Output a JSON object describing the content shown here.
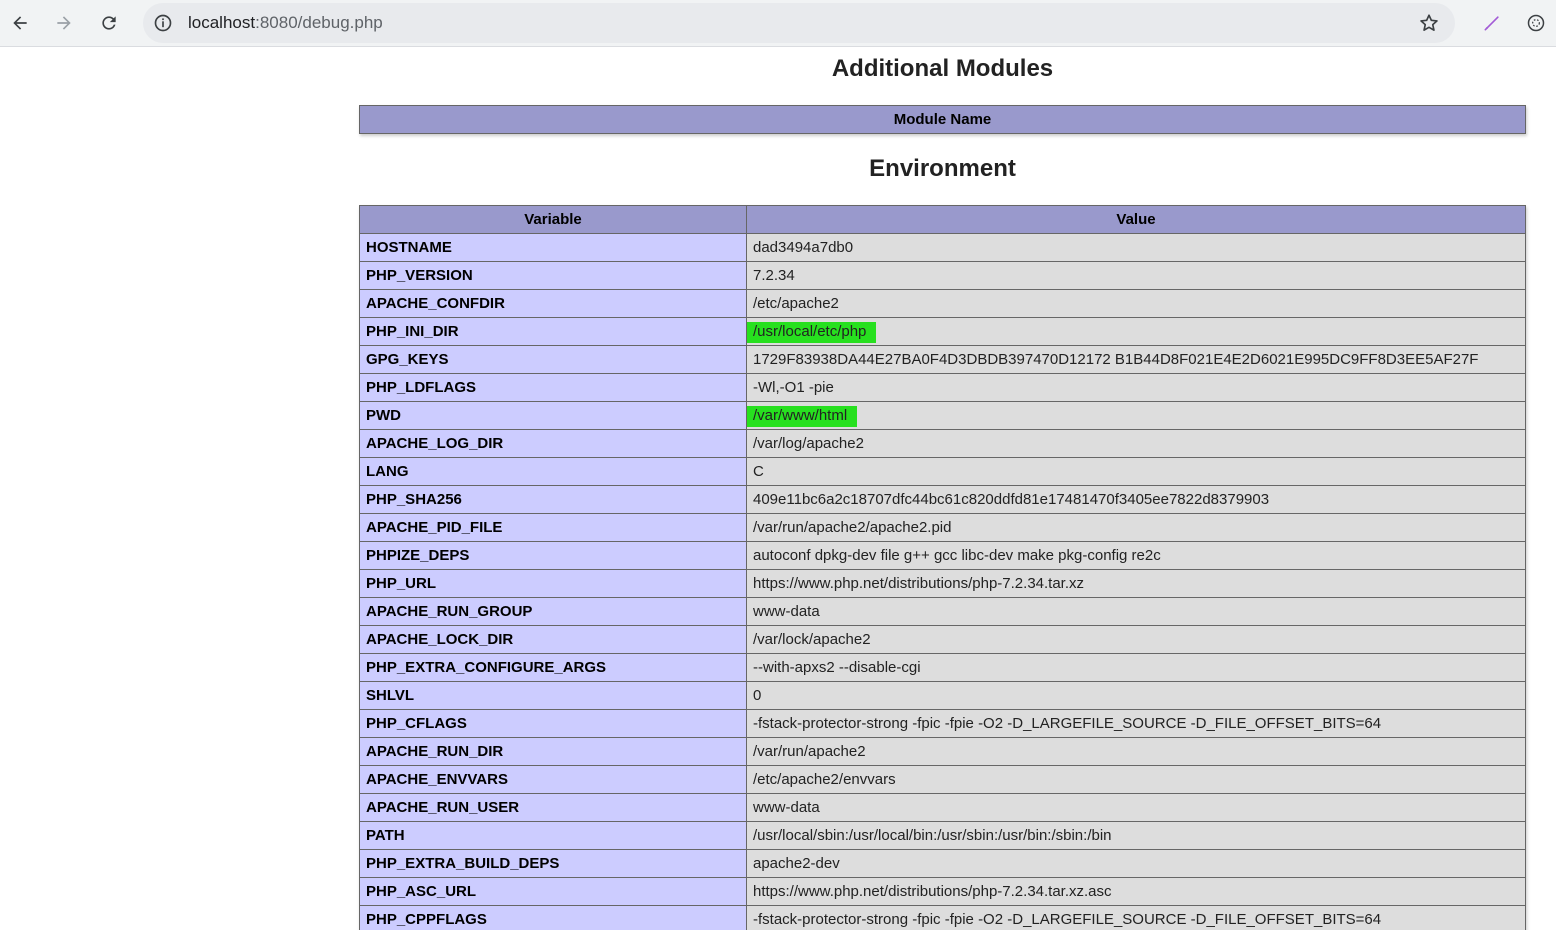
{
  "browser": {
    "url_host": "localhost",
    "url_path": ":8080/debug.php"
  },
  "modules_section": {
    "title": "Additional Modules",
    "header": "Module Name"
  },
  "environment_section": {
    "title": "Environment",
    "headers": [
      "Variable",
      "Value"
    ],
    "rows": [
      {
        "name": "HOSTNAME",
        "value": "dad3494a7db0"
      },
      {
        "name": "PHP_VERSION",
        "value": "7.2.34"
      },
      {
        "name": "APACHE_CONFDIR",
        "value": "/etc/apache2"
      },
      {
        "name": "PHP_INI_DIR",
        "value": "/usr/local/etc/php",
        "highlight": true
      },
      {
        "name": "GPG_KEYS",
        "value": "1729F83938DA44E27BA0F4D3DBDB397470D12172 B1B44D8F021E4E2D6021E995DC9FF8D3EE5AF27F"
      },
      {
        "name": "PHP_LDFLAGS",
        "value": "-Wl,-O1 -pie"
      },
      {
        "name": "PWD",
        "value": "/var/www/html",
        "highlight": true
      },
      {
        "name": "APACHE_LOG_DIR",
        "value": "/var/log/apache2"
      },
      {
        "name": "LANG",
        "value": "C"
      },
      {
        "name": "PHP_SHA256",
        "value": "409e11bc6a2c18707dfc44bc61c820ddfd81e17481470f3405ee7822d8379903"
      },
      {
        "name": "APACHE_PID_FILE",
        "value": "/var/run/apache2/apache2.pid"
      },
      {
        "name": "PHPIZE_DEPS",
        "value": "autoconf dpkg-dev file g++ gcc libc-dev make pkg-config re2c"
      },
      {
        "name": "PHP_URL",
        "value": "https://www.php.net/distributions/php-7.2.34.tar.xz"
      },
      {
        "name": "APACHE_RUN_GROUP",
        "value": "www-data"
      },
      {
        "name": "APACHE_LOCK_DIR",
        "value": "/var/lock/apache2"
      },
      {
        "name": "PHP_EXTRA_CONFIGURE_ARGS",
        "value": "--with-apxs2 --disable-cgi"
      },
      {
        "name": "SHLVL",
        "value": "0"
      },
      {
        "name": "PHP_CFLAGS",
        "value": "-fstack-protector-strong -fpic -fpie -O2 -D_LARGEFILE_SOURCE -D_FILE_OFFSET_BITS=64"
      },
      {
        "name": "APACHE_RUN_DIR",
        "value": "/var/run/apache2"
      },
      {
        "name": "APACHE_ENVVARS",
        "value": "/etc/apache2/envvars"
      },
      {
        "name": "APACHE_RUN_USER",
        "value": "www-data"
      },
      {
        "name": "PATH",
        "value": "/usr/local/sbin:/usr/local/bin:/usr/sbin:/usr/bin:/sbin:/bin"
      },
      {
        "name": "PHP_EXTRA_BUILD_DEPS",
        "value": "apache2-dev"
      },
      {
        "name": "PHP_ASC_URL",
        "value": "https://www.php.net/distributions/php-7.2.34.tar.xz.asc"
      },
      {
        "name": "PHP_CPPFLAGS",
        "value": "-fstack-protector-strong -fpic -fpie -O2 -D_LARGEFILE_SOURCE -D_FILE_OFFSET_BITS=64"
      }
    ]
  },
  "colors": {
    "header_bg": "#9999cc",
    "name_cell_bg": "#ccccff",
    "value_cell_bg": "#dddddd",
    "highlight": "#27e01f"
  }
}
